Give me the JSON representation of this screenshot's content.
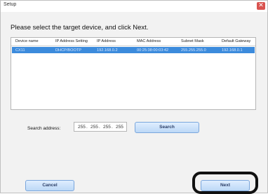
{
  "window": {
    "title": "Setup",
    "close_icon": "close-icon"
  },
  "instruction": "Please select the target device, and click Next.",
  "table": {
    "headers": [
      "Device name",
      "IP Address Setting",
      "IP Address",
      "MAC Address",
      "Subnet Mask",
      "Default Gateway"
    ],
    "rows": [
      [
        "CX11",
        "DHCP/BOOTP",
        "192.168.0.2",
        "00:25:38:00:03:42",
        "255.255.255.0",
        "192.168.0.1"
      ]
    ]
  },
  "search": {
    "label": "Search address:",
    "octets": [
      "255",
      "255",
      "255",
      "255"
    ],
    "button": "Search"
  },
  "footer": {
    "cancel": "Cancel",
    "next": "Next"
  },
  "colors": {
    "selected_row": "#3c8bdc",
    "button_fill": "#cfe3fb",
    "close": "#d9534f"
  }
}
